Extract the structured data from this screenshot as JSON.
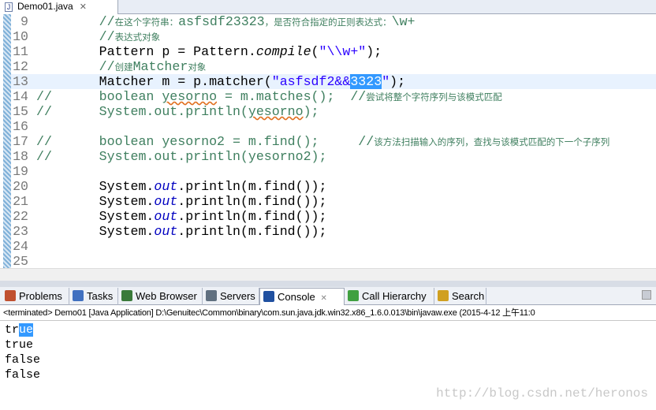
{
  "editor": {
    "tab_title": "Demo01.java",
    "tab_icon": "java-file-icon",
    "lines": [
      {
        "n": "9",
        "parts": [
          [
            "        ",
            ""
          ],
          [
            "//在这个字符串：asfsdf23323，是否符合指定的正则表达式：\\w+",
            "cm"
          ]
        ]
      },
      {
        "n": "10",
        "parts": [
          [
            "        ",
            ""
          ],
          [
            "//表达式对象",
            "cm"
          ]
        ]
      },
      {
        "n": "11",
        "parts": [
          [
            "        Pattern p = Pattern.",
            ""
          ],
          [
            "compile",
            "it"
          ],
          [
            "(",
            ""
          ],
          [
            "\"\\\\w+\"",
            "st"
          ],
          [
            ");",
            ""
          ]
        ]
      },
      {
        "n": "12",
        "parts": [
          [
            "        ",
            ""
          ],
          [
            "//创建Matcher对象",
            "cm"
          ]
        ]
      },
      {
        "n": "13",
        "parts": [
          [
            "        Matcher m = p.matcher(",
            ""
          ],
          [
            "\"asfsdf2&&",
            "st"
          ],
          [
            "3323",
            "sel"
          ],
          [
            "\"",
            "st"
          ],
          [
            ");",
            ""
          ]
        ],
        "current": true
      },
      {
        "n": "14",
        "parts": [
          [
            "//      boolean ",
            "cm"
          ],
          [
            "yesorno",
            "cm sq"
          ],
          [
            " = m.matches();  //尝试将整个字符序列与该模式匹配",
            "cm"
          ]
        ]
      },
      {
        "n": "15",
        "parts": [
          [
            "//      System.out.println(",
            "cm"
          ],
          [
            "yesorno",
            "cm sq"
          ],
          [
            ");",
            "cm"
          ]
        ]
      },
      {
        "n": "16",
        "parts": []
      },
      {
        "n": "17",
        "parts": [
          [
            "//      boolean yesorno2 = m.find();     //该方法扫描输入的序列，查找与该模式匹配的下一个子序列",
            "cm"
          ]
        ]
      },
      {
        "n": "18",
        "parts": [
          [
            "//      System.out.println(yesorno2);",
            "cm"
          ]
        ]
      },
      {
        "n": "19",
        "parts": []
      },
      {
        "n": "20",
        "parts": [
          [
            "        System.",
            ""
          ],
          [
            "out",
            "fld"
          ],
          [
            ".println(m.find());",
            ""
          ]
        ]
      },
      {
        "n": "21",
        "parts": [
          [
            "        System.",
            ""
          ],
          [
            "out",
            "fld"
          ],
          [
            ".println(m.find());",
            ""
          ]
        ]
      },
      {
        "n": "22",
        "parts": [
          [
            "        System.",
            ""
          ],
          [
            "out",
            "fld"
          ],
          [
            ".println(m.find());",
            ""
          ]
        ]
      },
      {
        "n": "23",
        "parts": [
          [
            "        System.",
            ""
          ],
          [
            "out",
            "fld"
          ],
          [
            ".println(m.find());",
            ""
          ]
        ]
      },
      {
        "n": "24",
        "parts": []
      },
      {
        "n": "25",
        "parts": []
      }
    ]
  },
  "views": {
    "tabs": [
      {
        "label": "Problems",
        "icon": "problems-icon",
        "color": "#c05030"
      },
      {
        "label": "Tasks",
        "icon": "tasks-icon",
        "color": "#4070c0"
      },
      {
        "label": "Web Browser",
        "icon": "globe-icon",
        "color": "#3a7a3a"
      },
      {
        "label": "Servers",
        "icon": "servers-icon",
        "color": "#607080"
      },
      {
        "label": "Console",
        "icon": "console-icon",
        "color": "#2050a0",
        "active": true
      },
      {
        "label": "Call Hierarchy",
        "icon": "call-hierarchy-icon",
        "color": "#40a040"
      },
      {
        "label": "Search",
        "icon": "search-icon",
        "color": "#d0a020"
      }
    ]
  },
  "console": {
    "header": "<terminated> Demo01 [Java Application] D:\\Genuitec\\Common\\binary\\com.sun.java.jdk.win32.x86_1.6.0.013\\bin\\javaw.exe (2015-4-12 上午11:0",
    "output": [
      "true",
      "true",
      "false",
      "false"
    ],
    "selected_first": "ue"
  },
  "watermark": "http://blog.csdn.net/heronos"
}
